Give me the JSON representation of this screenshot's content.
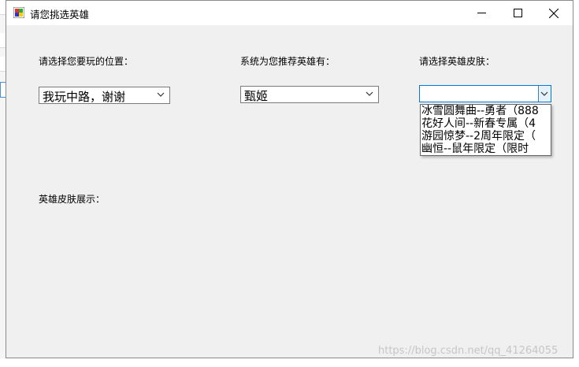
{
  "window": {
    "title": "请您挑选英雄",
    "controls": [
      "minimize-icon",
      "maximize-icon",
      "close-icon"
    ]
  },
  "labels": {
    "position": "请选择您要玩的位置：",
    "recommend": "系统为您推荐英雄有：",
    "skin": "请选择英雄皮肤：",
    "skin_display": "英雄皮肤展示："
  },
  "combos": {
    "position": {
      "value": "我玩中路，谢谢"
    },
    "hero": {
      "value": "甄姬"
    },
    "skin": {
      "value": "",
      "options": [
        "冰雪圆舞曲--勇者（888",
        "花好人间--新春专属（4",
        "游园惊梦--2周年限定（",
        "幽恒--鼠年限定（限时"
      ]
    }
  },
  "watermark": "https://blog.csdn.net/qq_41264055",
  "colors": {
    "accent": "#0078d7",
    "window_bg": "#f0f0f0"
  }
}
